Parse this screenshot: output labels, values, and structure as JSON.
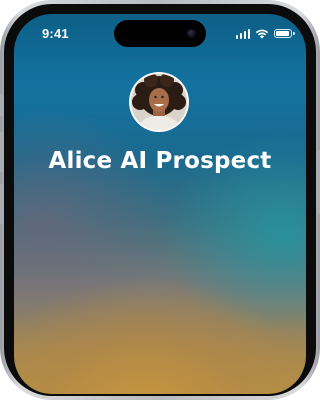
{
  "status_bar": {
    "time": "9:41",
    "signal_bars_active": 4,
    "wifi_icon": "wifi-icon",
    "battery_level": 1.0
  },
  "call": {
    "avatar_icon": "contact-avatar-photo",
    "contact_name": "Alice AI Prospect"
  },
  "colors": {
    "screen_top": "#0d5f86",
    "screen_bottom": "#b69144",
    "text": "#ffffff"
  }
}
